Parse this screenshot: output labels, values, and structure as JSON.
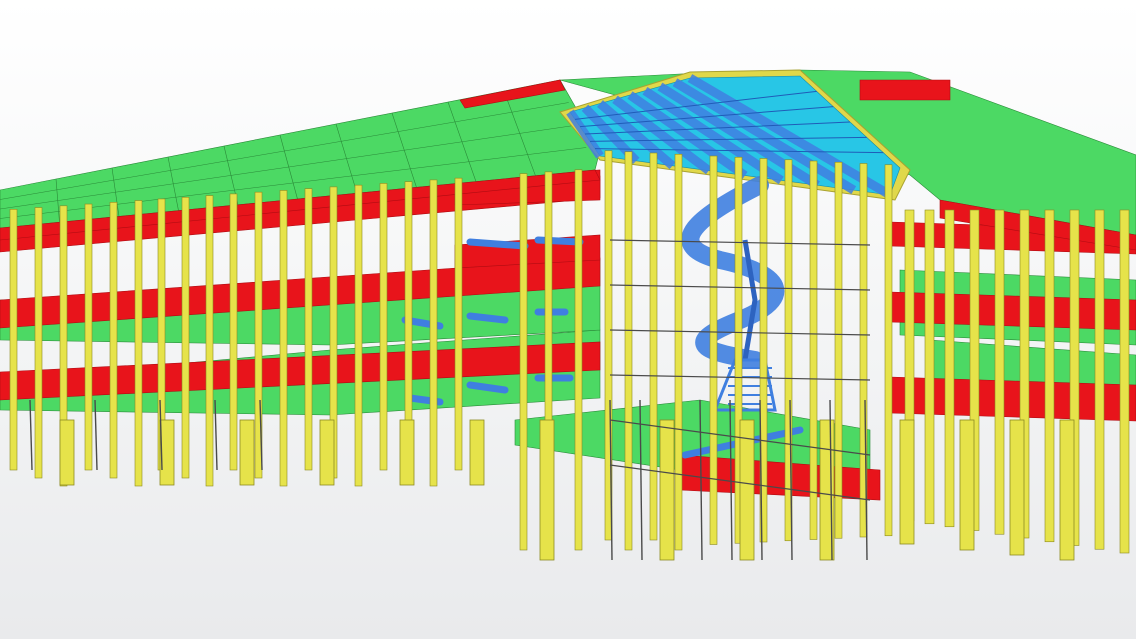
{
  "viewport": {
    "view": "3d-structural-model",
    "background": "#f4f5f6"
  },
  "model": {
    "element_colors": {
      "slab": "#4cd964",
      "slab_edge": "#2a8a38",
      "beam": "#e8141b",
      "beam_shadow": "#b00c12",
      "column": "#e6e34a",
      "column_edge": "#8c8a22",
      "roof_steel": "#3f7fe0",
      "roof_panel": "#28c6e6",
      "roof_edge": "#e0d84a",
      "stair": "#3f7fe0",
      "rebar": "#4a4a4a"
    },
    "visible_elements": [
      "slab",
      "beam",
      "column",
      "roof-steel",
      "roof-panel",
      "stair",
      "rebar"
    ]
  }
}
